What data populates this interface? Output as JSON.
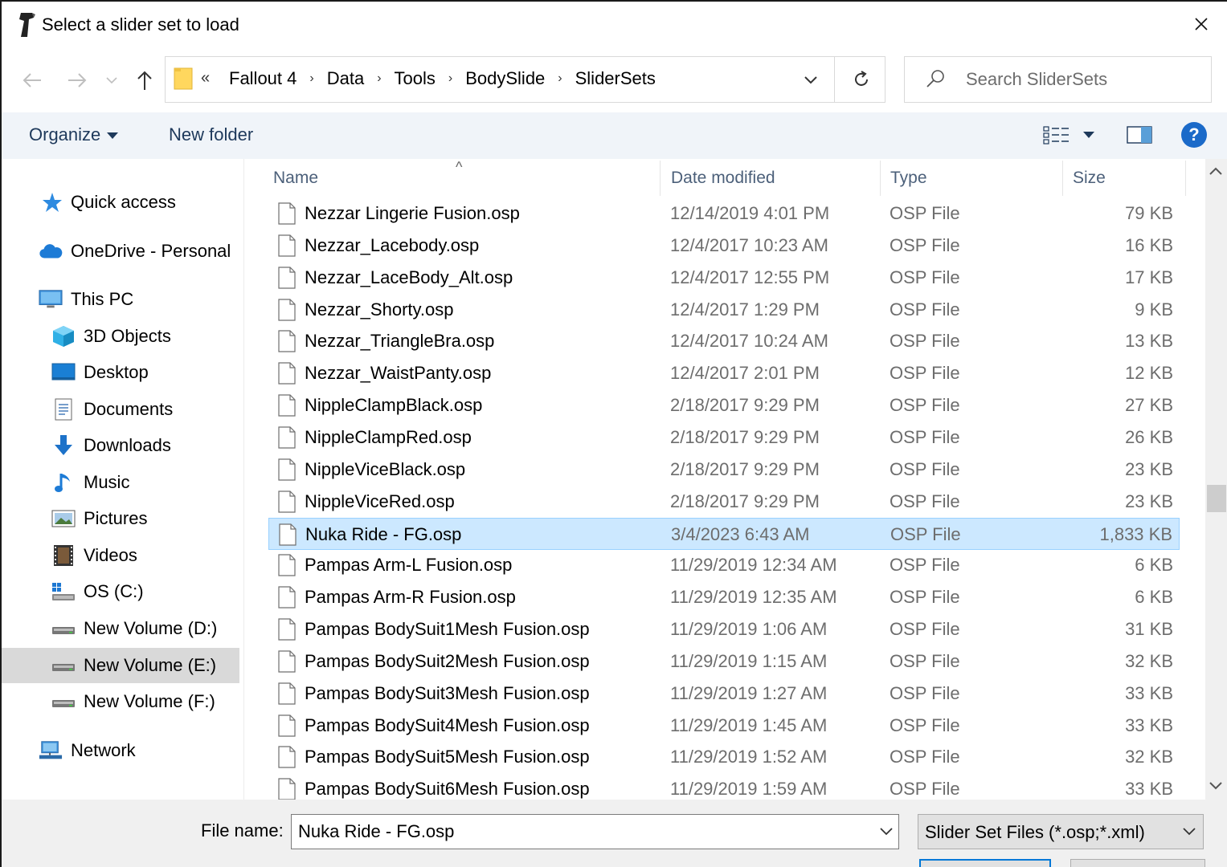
{
  "window": {
    "title": "Select a slider set to load"
  },
  "address": {
    "overflow": "«",
    "crumbs": [
      "Fallout 4",
      "Data",
      "Tools",
      "BodySlide",
      "SliderSets"
    ]
  },
  "search": {
    "placeholder": "Search SliderSets"
  },
  "toolbar": {
    "organize": "Organize",
    "new_folder": "New folder",
    "help": "?"
  },
  "navpane": {
    "items": [
      {
        "label": "Quick access",
        "icon": "quick-access-star-icon"
      },
      {
        "label": "OneDrive - Personal",
        "icon": "onedrive-cloud-icon"
      },
      {
        "label": "This PC",
        "icon": "monitor-icon"
      },
      {
        "label": "3D Objects",
        "icon": "cube-icon"
      },
      {
        "label": "Desktop",
        "icon": "desktop-icon"
      },
      {
        "label": "Documents",
        "icon": "document-icon"
      },
      {
        "label": "Downloads",
        "icon": "download-arrow-icon"
      },
      {
        "label": "Music",
        "icon": "music-note-icon"
      },
      {
        "label": "Pictures",
        "icon": "picture-icon"
      },
      {
        "label": "Videos",
        "icon": "film-icon"
      },
      {
        "label": "OS (C:)",
        "icon": "system-drive-icon"
      },
      {
        "label": "New Volume (D:)",
        "icon": "drive-icon"
      },
      {
        "label": "New Volume (E:)",
        "icon": "drive-icon"
      },
      {
        "label": "New Volume (F:)",
        "icon": "drive-icon"
      },
      {
        "label": "Network",
        "icon": "network-icon"
      }
    ],
    "selected": "New Volume (E:)"
  },
  "filelist": {
    "columns": {
      "name": "Name",
      "date": "Date modified",
      "type": "Type",
      "size": "Size"
    },
    "rows": [
      {
        "name": "Nezzar Lingerie Fusion.osp",
        "date": "12/14/2019 4:01 PM",
        "type": "OSP File",
        "size": "79 KB"
      },
      {
        "name": "Nezzar_Lacebody.osp",
        "date": "12/4/2017 10:23 AM",
        "type": "OSP File",
        "size": "16 KB"
      },
      {
        "name": "Nezzar_LaceBody_Alt.osp",
        "date": "12/4/2017 12:55 PM",
        "type": "OSP File",
        "size": "17 KB"
      },
      {
        "name": "Nezzar_Shorty.osp",
        "date": "12/4/2017 1:29 PM",
        "type": "OSP File",
        "size": "9 KB"
      },
      {
        "name": "Nezzar_TriangleBra.osp",
        "date": "12/4/2017 10:24 AM",
        "type": "OSP File",
        "size": "13 KB"
      },
      {
        "name": "Nezzar_WaistPanty.osp",
        "date": "12/4/2017 2:01 PM",
        "type": "OSP File",
        "size": "12 KB"
      },
      {
        "name": "NippleClampBlack.osp",
        "date": "2/18/2017 9:29 PM",
        "type": "OSP File",
        "size": "27 KB"
      },
      {
        "name": "NippleClampRed.osp",
        "date": "2/18/2017 9:29 PM",
        "type": "OSP File",
        "size": "26 KB"
      },
      {
        "name": "NippleViceBlack.osp",
        "date": "2/18/2017 9:29 PM",
        "type": "OSP File",
        "size": "23 KB"
      },
      {
        "name": "NippleViceRed.osp",
        "date": "2/18/2017 9:29 PM",
        "type": "OSP File",
        "size": "23 KB"
      },
      {
        "name": "Nuka Ride - FG.osp",
        "date": "3/4/2023 6:43 AM",
        "type": "OSP File",
        "size": "1,833 KB"
      },
      {
        "name": "Pampas Arm-L Fusion.osp",
        "date": "11/29/2019 12:34 AM",
        "type": "OSP File",
        "size": "6 KB"
      },
      {
        "name": "Pampas Arm-R Fusion.osp",
        "date": "11/29/2019 12:35 AM",
        "type": "OSP File",
        "size": "6 KB"
      },
      {
        "name": "Pampas BodySuit1Mesh Fusion.osp",
        "date": "11/29/2019 1:06 AM",
        "type": "OSP File",
        "size": "31 KB"
      },
      {
        "name": "Pampas BodySuit2Mesh Fusion.osp",
        "date": "11/29/2019 1:15 AM",
        "type": "OSP File",
        "size": "32 KB"
      },
      {
        "name": "Pampas BodySuit3Mesh Fusion.osp",
        "date": "11/29/2019 1:27 AM",
        "type": "OSP File",
        "size": "33 KB"
      },
      {
        "name": "Pampas BodySuit4Mesh Fusion.osp",
        "date": "11/29/2019 1:45 AM",
        "type": "OSP File",
        "size": "33 KB"
      },
      {
        "name": "Pampas BodySuit5Mesh Fusion.osp",
        "date": "11/29/2019 1:52 AM",
        "type": "OSP File",
        "size": "32 KB"
      },
      {
        "name": "Pampas BodySuit6Mesh Fusion.osp",
        "date": "11/29/2019 1:59 AM",
        "type": "OSP File",
        "size": "33 KB"
      }
    ],
    "selected_row": 10
  },
  "bottom": {
    "file_name_label": "File name:",
    "file_name_value": "Nuka Ride - FG.osp",
    "file_type": "Slider Set Files (*.osp;*.xml)"
  },
  "colors": {
    "selection": "#cce8ff",
    "selection_border": "#99d1ff",
    "toolbar_bg": "#f0f4f9",
    "link_text": "#1e395b",
    "accent": "#0078d7"
  }
}
